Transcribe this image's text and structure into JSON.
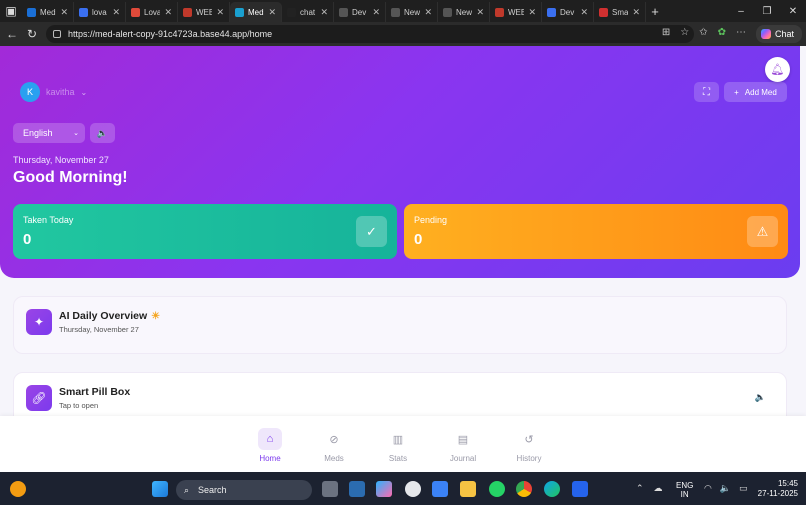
{
  "browser": {
    "tabs": [
      {
        "label": "Med",
        "color": "#1a6fd6"
      },
      {
        "label": "lova",
        "color": "#3a6ff0"
      },
      {
        "label": "Lova",
        "color": "#e04a3a"
      },
      {
        "label": "WEB",
        "color": "#c0392b"
      },
      {
        "label": "Med",
        "color": "#1aa0d0",
        "active": true
      },
      {
        "label": "chat",
        "color": "#222222"
      },
      {
        "label": "Dev",
        "color": "#555555"
      },
      {
        "label": "New",
        "color": "#555555"
      },
      {
        "label": "New",
        "color": "#555555"
      },
      {
        "label": "WEB",
        "color": "#c0392b"
      },
      {
        "label": "Dev",
        "color": "#3a6ff0"
      },
      {
        "label": "Sma",
        "color": "#d03030"
      }
    ],
    "url": "https://med-alert-copy-91c4723a.base44.app/home",
    "chat_label": "Chat"
  },
  "header": {
    "user_initial": "K",
    "user_name": "kavitha",
    "add_med_label": "Add Med",
    "language": "English",
    "date": "Thursday, November 27",
    "greeting": "Good Morning!"
  },
  "stats": {
    "taken_label": "Taken Today",
    "taken_value": "0",
    "pending_label": "Pending",
    "pending_value": "0"
  },
  "ai_overview": {
    "title": "AI Daily Overview",
    "date": "Thursday, November 27"
  },
  "pill_box": {
    "title": "Smart Pill Box",
    "subtitle": "Tap to open"
  },
  "nav": {
    "items": [
      {
        "label": "Home",
        "icon": "home-icon",
        "active": true
      },
      {
        "label": "Meds",
        "icon": "pill-icon"
      },
      {
        "label": "Stats",
        "icon": "bar-chart-icon"
      },
      {
        "label": "Journal",
        "icon": "book-icon"
      },
      {
        "label": "History",
        "icon": "history-icon"
      }
    ]
  },
  "taskbar": {
    "search_placeholder": "Search",
    "lang_line1": "ENG",
    "lang_line2": "IN",
    "time": "15:45",
    "date": "27-11-2025"
  }
}
